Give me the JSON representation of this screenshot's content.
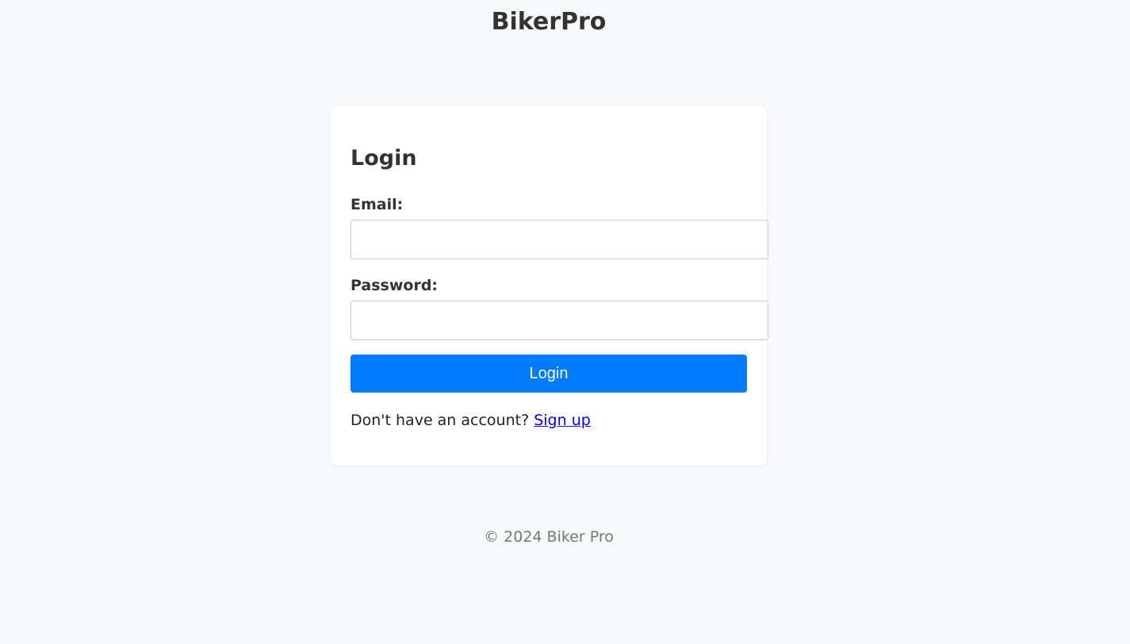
{
  "header": {
    "title": "BikerPro"
  },
  "login_form": {
    "title": "Login",
    "email_label": "Email:",
    "email_value": "",
    "password_label": "Password:",
    "password_value": "",
    "submit_label": "Login",
    "signup_prompt": "Don't have an account?",
    "signup_link": "Sign up"
  },
  "footer": {
    "copyright": "© 2024 Biker Pro"
  },
  "colors": {
    "background": "#f8f9fa",
    "card": "#ffffff",
    "primary_button": "#007bff",
    "link": "#0000ee",
    "footer_text": "#777777"
  }
}
